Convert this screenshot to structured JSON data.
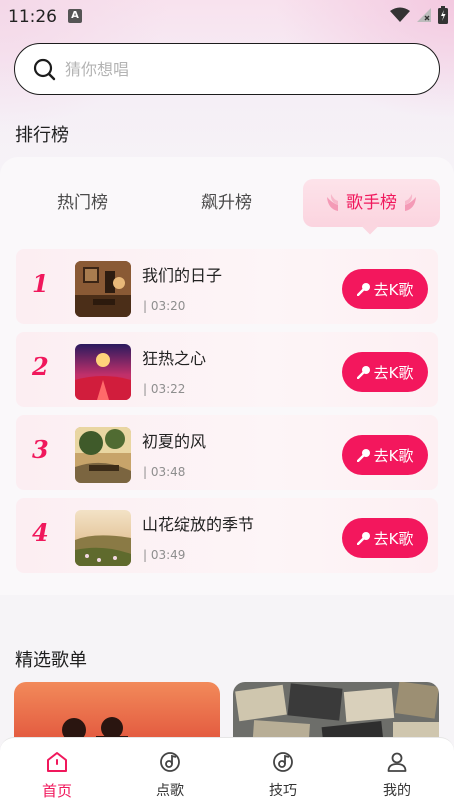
{
  "status_bar": {
    "time": "11:26",
    "notification_letter": "A"
  },
  "search": {
    "placeholder": "猜你想唱"
  },
  "sections": {
    "ranking_title": "排行榜",
    "playlist_title": "精选歌单"
  },
  "tabs": [
    {
      "label": "热门榜",
      "active": false
    },
    {
      "label": "飙升榜",
      "active": false
    },
    {
      "label": "歌手榜",
      "active": true
    }
  ],
  "songs": [
    {
      "rank": "1",
      "title": "我们的日子",
      "duration": "| 03:20",
      "button": "去K歌"
    },
    {
      "rank": "2",
      "title": "狂热之心",
      "duration": "| 03:22",
      "button": "去K歌"
    },
    {
      "rank": "3",
      "title": "初夏的风",
      "duration": "| 03:48",
      "button": "去K歌"
    },
    {
      "rank": "4",
      "title": "山花绽放的季节",
      "duration": "| 03:49",
      "button": "去K歌"
    }
  ],
  "bottom_nav": [
    {
      "label": "首页",
      "icon": "home-icon",
      "active": true
    },
    {
      "label": "点歌",
      "icon": "music-disc-icon",
      "active": false
    },
    {
      "label": "技巧",
      "icon": "tips-disc-icon",
      "active": false
    },
    {
      "label": "我的",
      "icon": "person-icon",
      "active": false
    }
  ],
  "colors": {
    "accent": "#f0185c",
    "button": "#f3175d",
    "tab_active_bg": "#fde3ea"
  }
}
